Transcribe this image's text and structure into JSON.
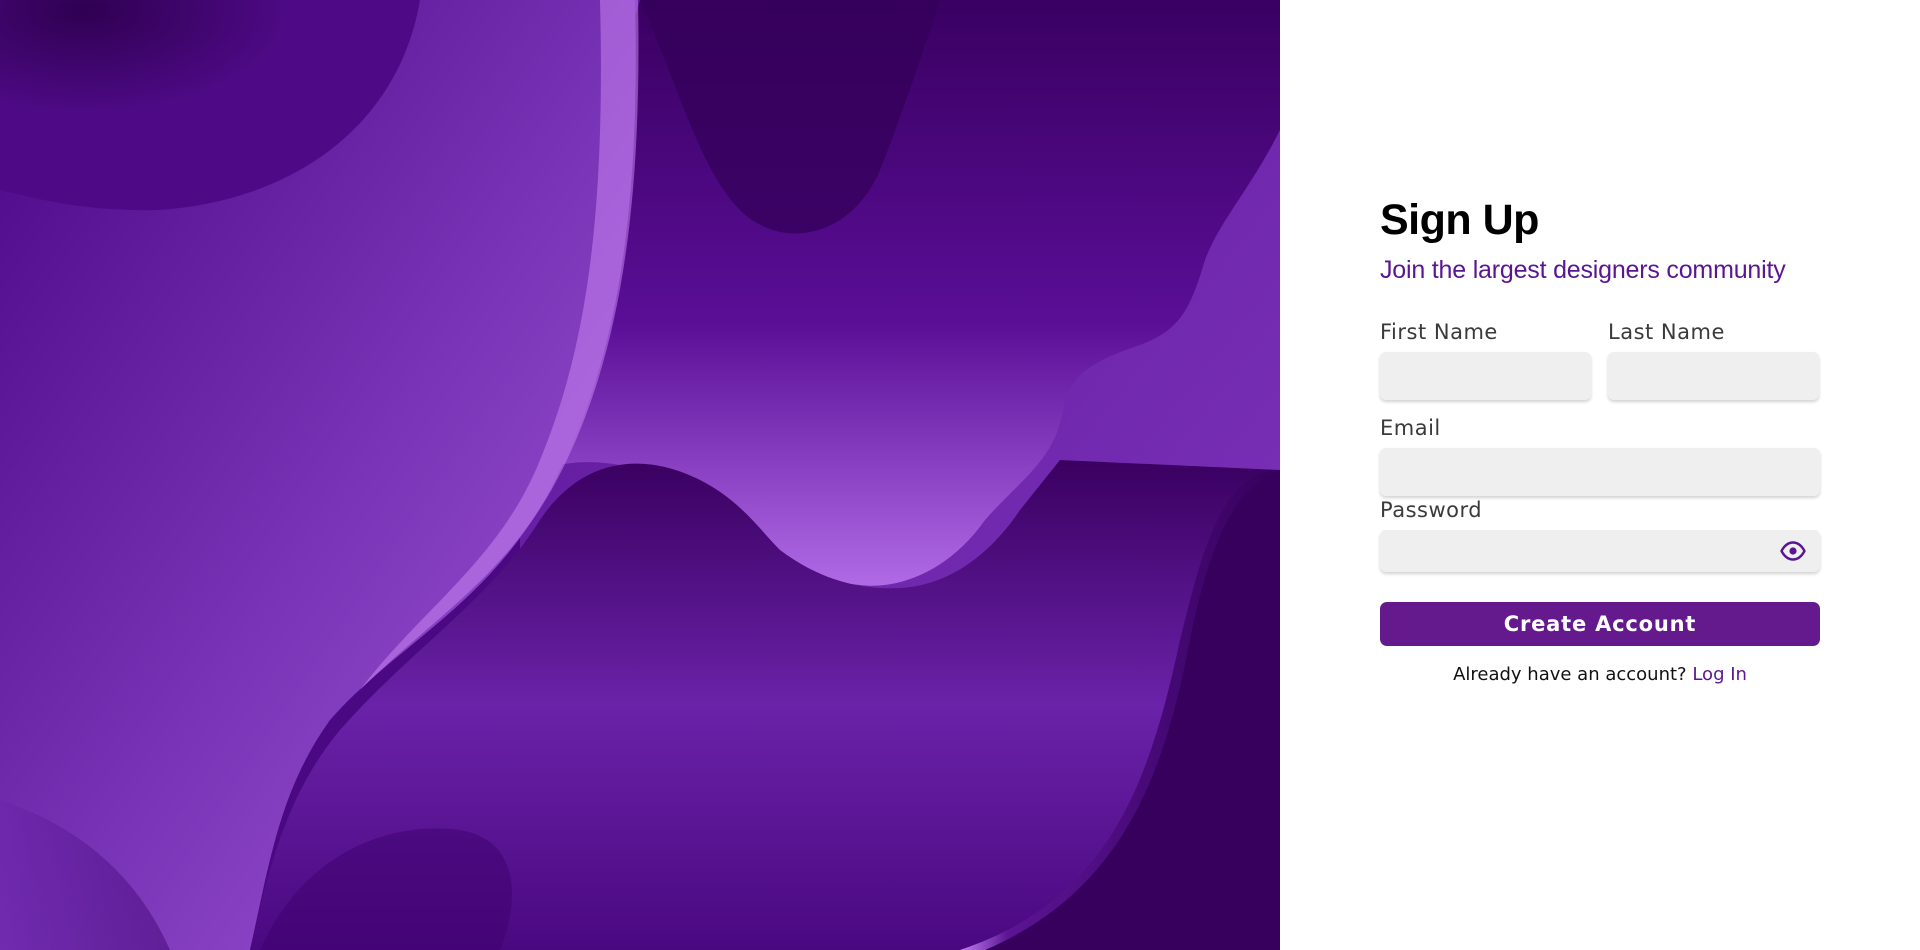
{
  "signup": {
    "title": "Sign Up",
    "subtitle": "Join the largest designers community",
    "first_name_label": "First Name",
    "last_name_label": "Last Name",
    "email_label": "Email",
    "password_label": "Password",
    "first_name_value": "",
    "last_name_value": "",
    "email_value": "",
    "password_value": "",
    "password_toggle_icon": "eye-icon",
    "submit_label": "Create Account",
    "footer_text": "Already have an account?",
    "login_link": "Log In"
  },
  "colors": {
    "accent": "#641a8c",
    "subtitle": "#5a1590",
    "hero_dark": "#3a0060",
    "hero_light": "#b06ae6",
    "input_bg": "#efefef"
  }
}
